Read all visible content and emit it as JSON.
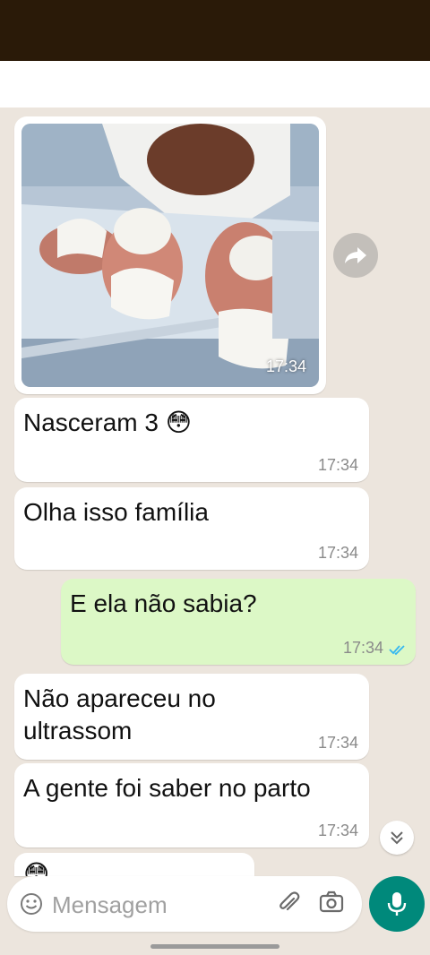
{
  "messages": [
    {
      "text": "Nasceram 3 😳",
      "time": "17:34",
      "direction": "in"
    },
    {
      "text": "Olha isso família",
      "time": "17:34",
      "direction": "in"
    },
    {
      "text": "E ela não sabia?",
      "time": "17:34",
      "direction": "out",
      "status": "read"
    },
    {
      "text": "Não apareceu no\nultrassom",
      "time": "17:34",
      "direction": "in"
    },
    {
      "text": "A gente foi saber no parto",
      "time": "17:34",
      "direction": "in"
    },
    {
      "text": "😳",
      "direction": "in"
    }
  ],
  "image_message": {
    "time": "17:34",
    "subject": "three newborn babies in hospital bassinet"
  },
  "composer": {
    "placeholder": "Mensagem"
  },
  "colors": {
    "status_bar": "#2a1a08",
    "chat_bg": "#ece5dd",
    "incoming_bubble": "#ffffff",
    "outgoing_bubble": "#dcf8c6",
    "read_ticks": "#34b7f1",
    "mic_button": "#00897b"
  },
  "icons": [
    "forward-icon",
    "scroll-down-icon",
    "emoji-icon",
    "attach-icon",
    "camera-icon",
    "mic-icon",
    "double-check-icon"
  ]
}
